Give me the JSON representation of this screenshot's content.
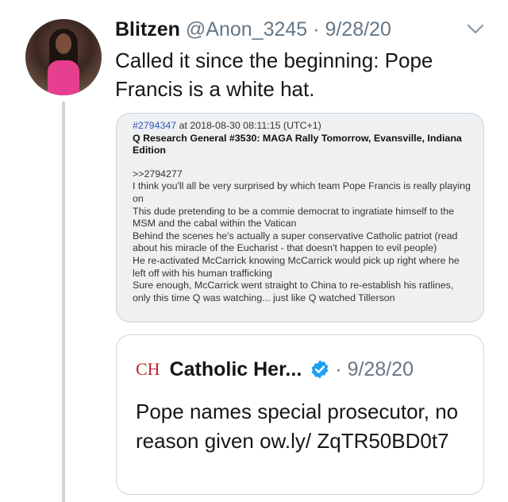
{
  "tweet": {
    "display_name": "Blitzen",
    "handle": "@Anon_3245",
    "separator": "·",
    "date": "9/28/20",
    "text": "Called it since the beginning: Pope Francis is a white hat."
  },
  "media": {
    "post_id": "#2794347",
    "post_meta": " at 2018-08-30 08:11:15 (UTC+1)",
    "post_title": "Q Research General #3530: MAGA Rally Tomorrow, Evansville, Indiana Edition",
    "reply_ref": ">>2794277",
    "lines": [
      "I think you'll all be very surprised by which team Pope Francis is really playing on",
      "This dude pretending to be a commie democrat to ingratiate himself to the MSM and the cabal within the Vatican",
      "Behind the scenes he's actually a super conservative Catholic patriot (read about his miracle of the Eucharist - that doesn't happen to evil people)",
      "He re-activated McCarrick knowing McCarrick would pick up right where he left off with his human trafficking",
      "Sure enough, McCarrick went straight to China to re-establish his ratlines, only this time Q was watching... just like Q watched Tillerson"
    ]
  },
  "quoted": {
    "logo": "CH",
    "name": "Catholic Her...",
    "separator": "·",
    "date": "9/28/20",
    "text": "Pope names special prosecutor, no reason given ow.ly/ ZqTR50BD0t7"
  },
  "colors": {
    "accent": "#1da1f2",
    "secondary_text": "#657786",
    "brand_red": "#c0272d"
  },
  "icons": {
    "menu": "chevron-down-icon",
    "verified": "verified-badge-icon"
  }
}
